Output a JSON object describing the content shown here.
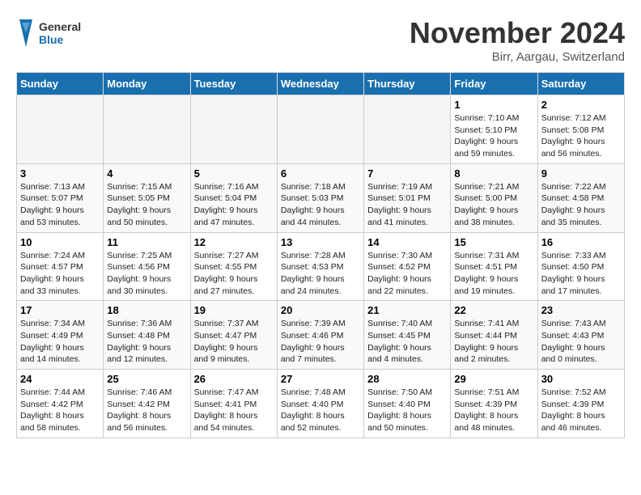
{
  "logo": {
    "line1": "General",
    "line2": "Blue"
  },
  "title": "November 2024",
  "location": "Birr, Aargau, Switzerland",
  "days_of_week": [
    "Sunday",
    "Monday",
    "Tuesday",
    "Wednesday",
    "Thursday",
    "Friday",
    "Saturday"
  ],
  "weeks": [
    [
      {
        "day": "",
        "info": ""
      },
      {
        "day": "",
        "info": ""
      },
      {
        "day": "",
        "info": ""
      },
      {
        "day": "",
        "info": ""
      },
      {
        "day": "",
        "info": ""
      },
      {
        "day": "1",
        "info": "Sunrise: 7:10 AM\nSunset: 5:10 PM\nDaylight: 9 hours and 59 minutes."
      },
      {
        "day": "2",
        "info": "Sunrise: 7:12 AM\nSunset: 5:08 PM\nDaylight: 9 hours and 56 minutes."
      }
    ],
    [
      {
        "day": "3",
        "info": "Sunrise: 7:13 AM\nSunset: 5:07 PM\nDaylight: 9 hours and 53 minutes."
      },
      {
        "day": "4",
        "info": "Sunrise: 7:15 AM\nSunset: 5:05 PM\nDaylight: 9 hours and 50 minutes."
      },
      {
        "day": "5",
        "info": "Sunrise: 7:16 AM\nSunset: 5:04 PM\nDaylight: 9 hours and 47 minutes."
      },
      {
        "day": "6",
        "info": "Sunrise: 7:18 AM\nSunset: 5:03 PM\nDaylight: 9 hours and 44 minutes."
      },
      {
        "day": "7",
        "info": "Sunrise: 7:19 AM\nSunset: 5:01 PM\nDaylight: 9 hours and 41 minutes."
      },
      {
        "day": "8",
        "info": "Sunrise: 7:21 AM\nSunset: 5:00 PM\nDaylight: 9 hours and 38 minutes."
      },
      {
        "day": "9",
        "info": "Sunrise: 7:22 AM\nSunset: 4:58 PM\nDaylight: 9 hours and 35 minutes."
      }
    ],
    [
      {
        "day": "10",
        "info": "Sunrise: 7:24 AM\nSunset: 4:57 PM\nDaylight: 9 hours and 33 minutes."
      },
      {
        "day": "11",
        "info": "Sunrise: 7:25 AM\nSunset: 4:56 PM\nDaylight: 9 hours and 30 minutes."
      },
      {
        "day": "12",
        "info": "Sunrise: 7:27 AM\nSunset: 4:55 PM\nDaylight: 9 hours and 27 minutes."
      },
      {
        "day": "13",
        "info": "Sunrise: 7:28 AM\nSunset: 4:53 PM\nDaylight: 9 hours and 24 minutes."
      },
      {
        "day": "14",
        "info": "Sunrise: 7:30 AM\nSunset: 4:52 PM\nDaylight: 9 hours and 22 minutes."
      },
      {
        "day": "15",
        "info": "Sunrise: 7:31 AM\nSunset: 4:51 PM\nDaylight: 9 hours and 19 minutes."
      },
      {
        "day": "16",
        "info": "Sunrise: 7:33 AM\nSunset: 4:50 PM\nDaylight: 9 hours and 17 minutes."
      }
    ],
    [
      {
        "day": "17",
        "info": "Sunrise: 7:34 AM\nSunset: 4:49 PM\nDaylight: 9 hours and 14 minutes."
      },
      {
        "day": "18",
        "info": "Sunrise: 7:36 AM\nSunset: 4:48 PM\nDaylight: 9 hours and 12 minutes."
      },
      {
        "day": "19",
        "info": "Sunrise: 7:37 AM\nSunset: 4:47 PM\nDaylight: 9 hours and 9 minutes."
      },
      {
        "day": "20",
        "info": "Sunrise: 7:39 AM\nSunset: 4:46 PM\nDaylight: 9 hours and 7 minutes."
      },
      {
        "day": "21",
        "info": "Sunrise: 7:40 AM\nSunset: 4:45 PM\nDaylight: 9 hours and 4 minutes."
      },
      {
        "day": "22",
        "info": "Sunrise: 7:41 AM\nSunset: 4:44 PM\nDaylight: 9 hours and 2 minutes."
      },
      {
        "day": "23",
        "info": "Sunrise: 7:43 AM\nSunset: 4:43 PM\nDaylight: 9 hours and 0 minutes."
      }
    ],
    [
      {
        "day": "24",
        "info": "Sunrise: 7:44 AM\nSunset: 4:42 PM\nDaylight: 8 hours and 58 minutes."
      },
      {
        "day": "25",
        "info": "Sunrise: 7:46 AM\nSunset: 4:42 PM\nDaylight: 8 hours and 56 minutes."
      },
      {
        "day": "26",
        "info": "Sunrise: 7:47 AM\nSunset: 4:41 PM\nDaylight: 8 hours and 54 minutes."
      },
      {
        "day": "27",
        "info": "Sunrise: 7:48 AM\nSunset: 4:40 PM\nDaylight: 8 hours and 52 minutes."
      },
      {
        "day": "28",
        "info": "Sunrise: 7:50 AM\nSunset: 4:40 PM\nDaylight: 8 hours and 50 minutes."
      },
      {
        "day": "29",
        "info": "Sunrise: 7:51 AM\nSunset: 4:39 PM\nDaylight: 8 hours and 48 minutes."
      },
      {
        "day": "30",
        "info": "Sunrise: 7:52 AM\nSunset: 4:39 PM\nDaylight: 8 hours and 46 minutes."
      }
    ]
  ]
}
